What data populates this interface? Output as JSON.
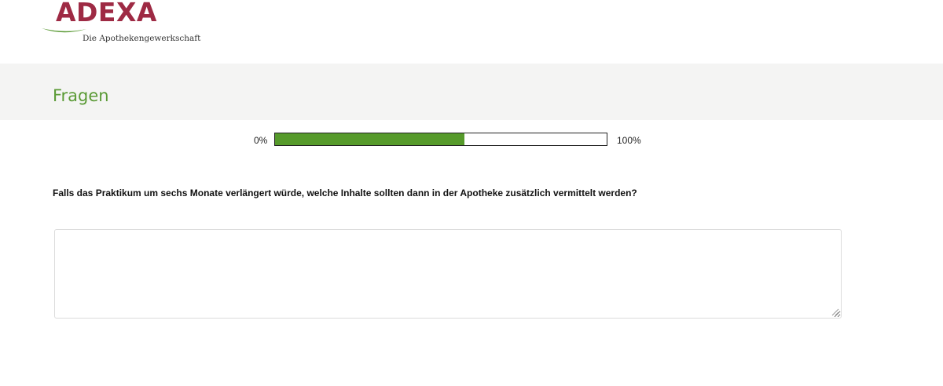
{
  "logo": {
    "wordmark": "ADEXA",
    "tagline": "Die Apothekengewerkschaft"
  },
  "header": {
    "title": "Fragen"
  },
  "progress": {
    "start_label": "0%",
    "end_label": "100%",
    "value_percent": 57,
    "fill_color": "#569a2b"
  },
  "question": {
    "text": "Falls das Praktikum um sechs Monate verlängert würde, welche Inhalte sollten dann in der Apotheke zusätzlich vermittelt werden?",
    "answer_value": "",
    "resize_icon": "resize-grip-icon"
  },
  "colors": {
    "brand_red": "#9e2a44",
    "brand_green": "#5a9a35",
    "band_background": "#f4f4f3"
  }
}
